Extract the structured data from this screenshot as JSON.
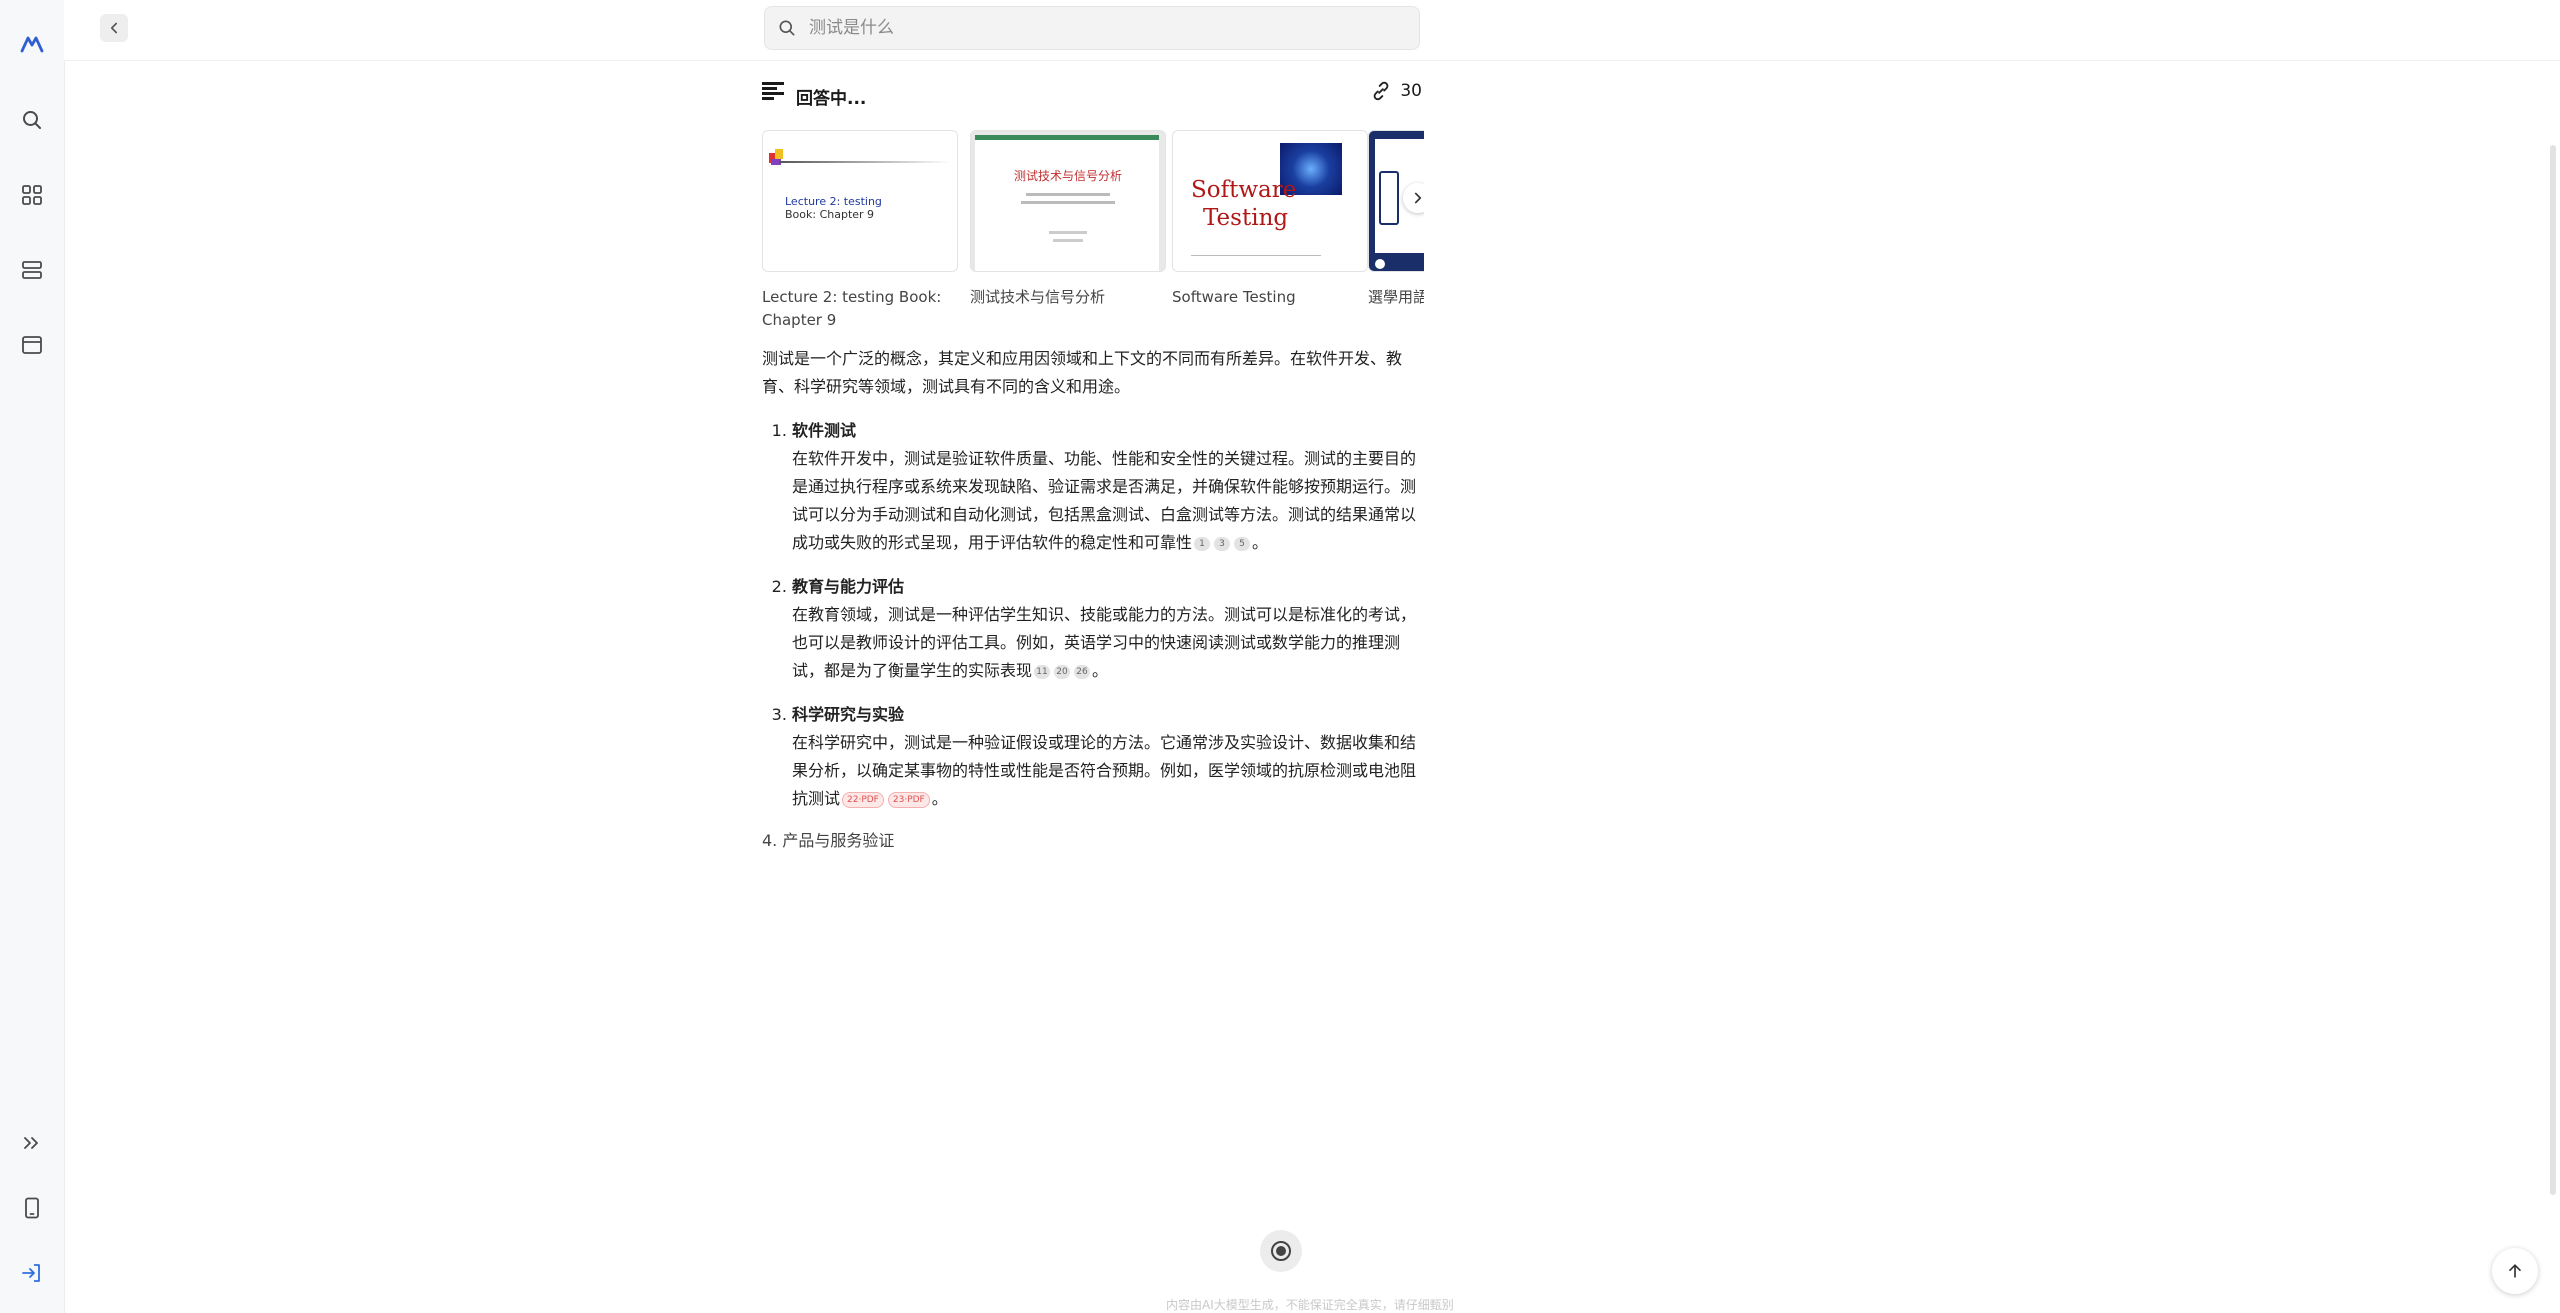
{
  "search": {
    "placeholder": "测试是什么"
  },
  "answer": {
    "status": "回答中...",
    "source_count": "30"
  },
  "sources": [
    {
      "title": "Lecture 2: testing Book: Chapter 9",
      "thumb_line1": "Lecture 2: testing",
      "thumb_line2": "Book: Chapter 9"
    },
    {
      "title": "测试技术与信号分析",
      "thumb_title": "测试技术与信号分析"
    },
    {
      "title": "Software Testing",
      "thumb_line1": "Software",
      "thumb_line2": "Testing"
    },
    {
      "title": "選學用語"
    }
  ],
  "content": {
    "intro": "测试是一个广泛的概念，其定义和应用因领域和上下文的不同而有所差异。在软件开发、教育、科学研究等领域，测试具有不同的含义和用途。",
    "items": [
      {
        "heading": "软件测试",
        "text": "在软件开发中，测试是验证软件质量、功能、性能和安全性的关键过程。测试的主要目的是通过执行程序或系统来发现缺陷、验证需求是否满足，并确保软件能够按预期运行。测试可以分为手动测试和自动化测试，包括黑盒测试、白盒测试等方法。测试的结果通常以成功或失败的形式呈现，用于评估软件的稳定性和可靠性",
        "cites": [
          "1",
          "3",
          "5"
        ]
      },
      {
        "heading": "教育与能力评估",
        "text": "在教育领域，测试是一种评估学生知识、技能或能力的方法。测试可以是标准化的考试，也可以是教师设计的评估工具。例如，英语学习中的快速阅读测试或数学能力的推理测试，都是为了衡量学生的实际表现",
        "cites": [
          "11",
          "20",
          "26"
        ]
      },
      {
        "heading": "科学研究与实验",
        "text": "在科学研究中，测试是一种验证假设或理论的方法。它通常涉及实验设计、数据收集和结果分析，以确定某事物的特性或性能是否符合预期。例如，医学领域的抗原检测或电池阻抗测试",
        "cites": [
          "22·PDF",
          "23·PDF"
        ]
      }
    ],
    "period": "。",
    "pending_num": "4.",
    "pending_item": "产品与服务验证"
  },
  "footer": "内容由AI大模型生成，不能保证完全真实，请仔细甄别",
  "colors": {
    "accent": "#1f3a8a",
    "pdf_badge": "#e05050"
  }
}
